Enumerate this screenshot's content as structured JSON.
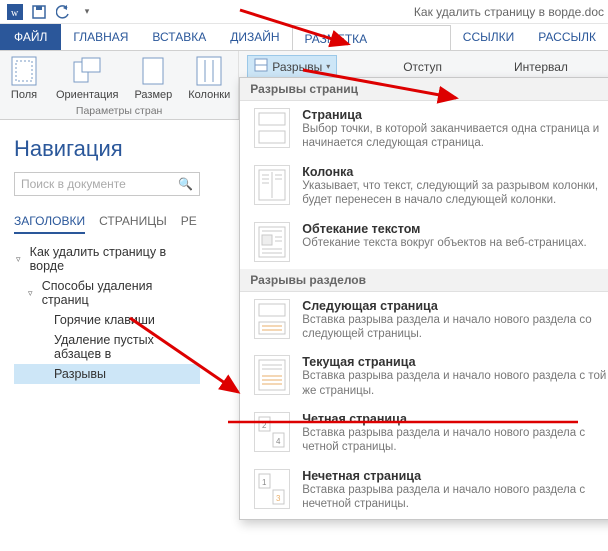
{
  "title": "Как удалить страницу в ворде.doc",
  "ribbon_tabs": {
    "file": "ФАЙЛ",
    "home": "ГЛАВНАЯ",
    "insert": "ВСТАВКА",
    "design": "ДИЗАЙН",
    "layout": "РАЗМЕТКА СТРАНИЦЫ",
    "references": "ССЫЛКИ",
    "mailings": "РАССЫЛК"
  },
  "ribbon": {
    "margins": "Поля",
    "orientation": "Ориентация",
    "size": "Размер",
    "columns": "Колонки",
    "group_label": "Параметры стран",
    "breaks": "Разрывы",
    "indent": "Отступ",
    "spacing": "Интервал"
  },
  "nav": {
    "title": "Навигация",
    "search_placeholder": "Поиск в документе",
    "tabs": {
      "headings": "ЗАГОЛОВКИ",
      "pages": "СТРАНИЦЫ",
      "results": "РЕ"
    },
    "tree": {
      "root": "Как удалить страницу в ворде",
      "n1": "Способы удаления страниц",
      "n1a": "Горячие клавиши",
      "n1b": "Удаление пустых абзацев в",
      "n1c": "Разрывы"
    }
  },
  "gallery": {
    "section1": "Разрывы страниц",
    "section2": "Разрывы разделов",
    "items": {
      "page": {
        "title": "Страница",
        "desc": "Выбор точки, в которой заканчивается одна страница и начинается следующая страница."
      },
      "column": {
        "title": "Колонка",
        "desc": "Указывает, что текст, следующий за разрывом колонки, будет перенесен в начало следующей колонки."
      },
      "wrap": {
        "title": "Обтекание текстом",
        "desc": "Обтекание текста вокруг объектов на веб-страницах."
      },
      "next": {
        "title": "Следующая страница",
        "desc": "Вставка разрыва раздела и начало нового раздела со следующей страницы."
      },
      "cont": {
        "title": "Текущая страница",
        "desc": "Вставка разрыва раздела и начало нового раздела с той же страницы."
      },
      "even": {
        "title": "Четная страница",
        "desc": "Вставка разрыва раздела и начало нового раздела с четной страницы."
      },
      "odd": {
        "title": "Нечетная страница",
        "desc": "Вставка разрыва раздела и начало нового раздела с нечетной страницы."
      }
    }
  }
}
